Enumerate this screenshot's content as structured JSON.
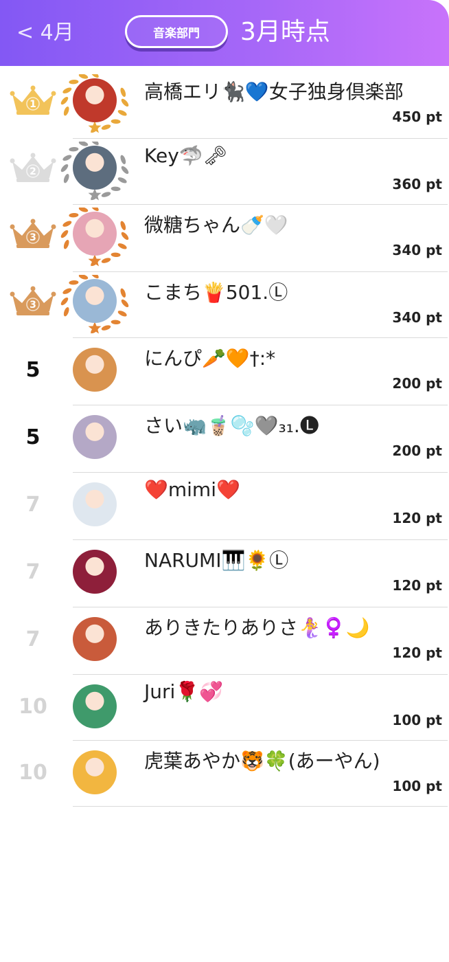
{
  "header": {
    "back_label": "< 4月",
    "department": "音楽部門",
    "period": "3月時点"
  },
  "colors": {
    "header_gradient_start": "#8358f4",
    "header_gradient_end": "#c873fb",
    "gold": "#f2c35a",
    "silver": "#c9c9c9",
    "bronze": "#d99a5c",
    "laurel_gold": "#e9a83a",
    "laurel_silver": "#9a9a9a",
    "laurel_bronze": "#e38432"
  },
  "ranking": [
    {
      "rank": "1",
      "tier": "gold",
      "name": "高橋エリ🐈‍⬛💙女子独身倶楽部",
      "points": "450 pt",
      "avatar": "avatar-panda-mascot",
      "avatar_color": "#c0392b"
    },
    {
      "rank": "2",
      "tier": "silver",
      "name": "Key🦈🗝",
      "points": "360 pt",
      "avatar": "avatar-person",
      "avatar_color": "#5d6d7e"
    },
    {
      "rank": "3",
      "tier": "bronze",
      "name": "微糖ちゃん🍼🤍",
      "points": "340 pt",
      "avatar": "avatar-person",
      "avatar_color": "#e6a5b5"
    },
    {
      "rank": "3",
      "tier": "bronze",
      "name": "こまち🍟501.Ⓛ",
      "points": "340 pt",
      "avatar": "avatar-person",
      "avatar_color": "#9ab8d6"
    },
    {
      "rank": "5",
      "tier": "none",
      "faded": false,
      "name": "にんぴ🥕🧡†:*",
      "points": "200 pt",
      "avatar": "avatar-person",
      "avatar_color": "#d9934f"
    },
    {
      "rank": "5",
      "tier": "none",
      "faded": false,
      "name": "さい🦏🧋🫧🩶₃₁.🅛",
      "points": "200 pt",
      "avatar": "avatar-person",
      "avatar_color": "#b4a8c6"
    },
    {
      "rank": "7",
      "tier": "none",
      "faded": true,
      "name": "❤️mimi❤️",
      "points": "120 pt",
      "avatar": "avatar-person",
      "avatar_color": "#dfe7ef"
    },
    {
      "rank": "7",
      "tier": "none",
      "faded": true,
      "name": "NARUMI🎹🌻Ⓛ",
      "points": "120 pt",
      "avatar": "avatar-person",
      "avatar_color": "#8e1f3a"
    },
    {
      "rank": "7",
      "tier": "none",
      "faded": true,
      "name": "ありきたりありさ🧜‍♀️♀️🌙",
      "points": "120 pt",
      "avatar": "avatar-person",
      "avatar_color": "#c95b3b"
    },
    {
      "rank": "10",
      "tier": "none",
      "faded": true,
      "name": "Juri🌹💞",
      "points": "100 pt",
      "avatar": "avatar-person",
      "avatar_color": "#3f9a6b"
    },
    {
      "rank": "10",
      "tier": "none",
      "faded": true,
      "name": "虎葉あやか🐯🍀(あーやん)",
      "points": "100 pt",
      "avatar": "avatar-person",
      "avatar_color": "#f2b640"
    }
  ]
}
